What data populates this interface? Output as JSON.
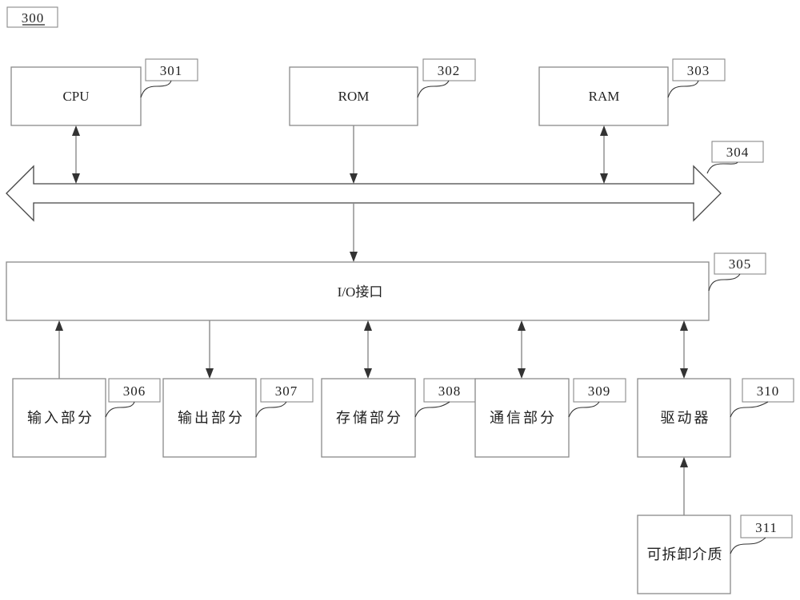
{
  "figure": {
    "id_label": "300"
  },
  "components": {
    "cpu": {
      "label": "CPU",
      "ref": "301"
    },
    "rom": {
      "label": "ROM",
      "ref": "302"
    },
    "ram": {
      "label": "RAM",
      "ref": "303"
    },
    "bus": {
      "ref": "304"
    },
    "io": {
      "label": "I/O接口",
      "ref": "305"
    },
    "input": {
      "label": "输入部分",
      "ref": "306"
    },
    "output": {
      "label": "输出部分",
      "ref": "307"
    },
    "storage": {
      "label": "存储部分",
      "ref": "308"
    },
    "comm": {
      "label": "通信部分",
      "ref": "309"
    },
    "driver": {
      "label": "驱动器",
      "ref": "310"
    },
    "media": {
      "label": "可拆卸介质",
      "ref": "311"
    }
  },
  "connections": [
    {
      "from": "cpu",
      "to": "bus",
      "direction": "bidirectional"
    },
    {
      "from": "rom",
      "to": "bus",
      "direction": "one-way"
    },
    {
      "from": "ram",
      "to": "bus",
      "direction": "bidirectional"
    },
    {
      "from": "bus",
      "to": "io",
      "direction": "one-way"
    },
    {
      "from": "input",
      "to": "io",
      "direction": "one-way"
    },
    {
      "from": "io",
      "to": "output",
      "direction": "one-way"
    },
    {
      "from": "storage",
      "to": "io",
      "direction": "bidirectional"
    },
    {
      "from": "comm",
      "to": "io",
      "direction": "bidirectional"
    },
    {
      "from": "driver",
      "to": "io",
      "direction": "bidirectional"
    },
    {
      "from": "media",
      "to": "driver",
      "direction": "one-way"
    }
  ]
}
